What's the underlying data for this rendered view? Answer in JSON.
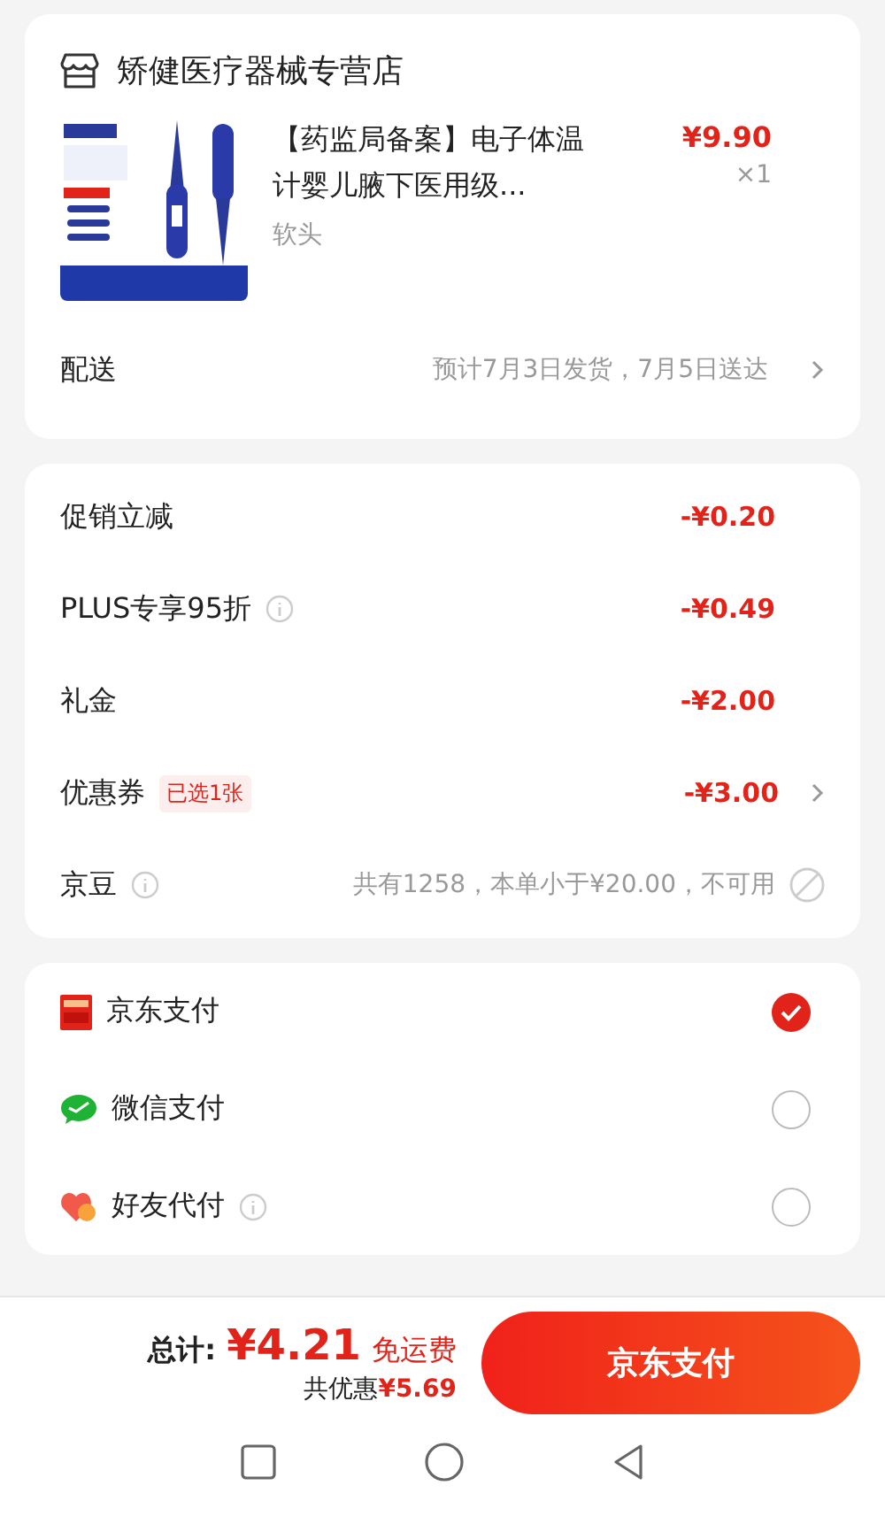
{
  "store": {
    "name": "矫健医疗器械专营店"
  },
  "product": {
    "title": "【药监局备案】电子体温计婴儿腋下医用级...",
    "spec": "软头",
    "price": "¥9.90",
    "quantity": "×1"
  },
  "delivery": {
    "label": "配送",
    "estimate": "预计7月3日发货，7月5日送达"
  },
  "discounts": [
    {
      "kind": "plain",
      "label": "促销立减",
      "info": false,
      "amount": "-¥0.20"
    },
    {
      "kind": "plain",
      "label": "PLUS专享95折",
      "info": true,
      "amount": "-¥0.49"
    },
    {
      "kind": "plain",
      "label": "礼金",
      "info": false,
      "amount": "-¥2.00"
    },
    {
      "kind": "link",
      "label": "优惠券",
      "info": false,
      "tag": "已选1张",
      "amount": "-¥3.00"
    },
    {
      "kind": "unavailable",
      "label": "京豆",
      "info": true,
      "note": "共有1258，本单小于¥20.00，不可用"
    }
  ],
  "payment_methods": [
    {
      "kind": "jdpay",
      "name": "京东支付",
      "info": false,
      "selected": true
    },
    {
      "kind": "wechat",
      "name": "微信支付",
      "info": false,
      "selected": false
    },
    {
      "kind": "friend",
      "name": "好友代付",
      "info": true,
      "selected": false
    }
  ],
  "footer": {
    "total_label": "总计:",
    "total": "¥4.21",
    "shipping": "免运费",
    "saving_label": "共优惠",
    "saving": "¥5.69",
    "pay_button": "京东支付"
  }
}
